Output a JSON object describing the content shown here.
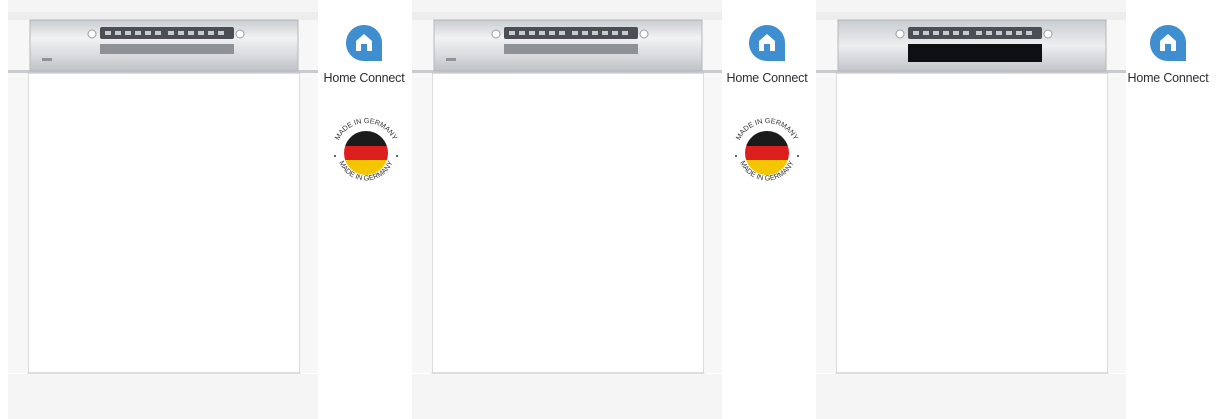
{
  "products": [
    {
      "panel_style": "steel",
      "has_made_in_germany": true
    },
    {
      "panel_style": "steel",
      "has_made_in_germany": true
    },
    {
      "panel_style": "black",
      "has_made_in_germany": false
    }
  ],
  "home_connect": {
    "label": "Home Connect",
    "icon": "home-connect-icon",
    "color": "#3f8fd0"
  },
  "seal": {
    "text": "MADE IN GERMANY",
    "icon": "made-in-germany-seal",
    "flag_colors": [
      "#1b1b1b",
      "#dd1e1e",
      "#f3c600"
    ]
  }
}
